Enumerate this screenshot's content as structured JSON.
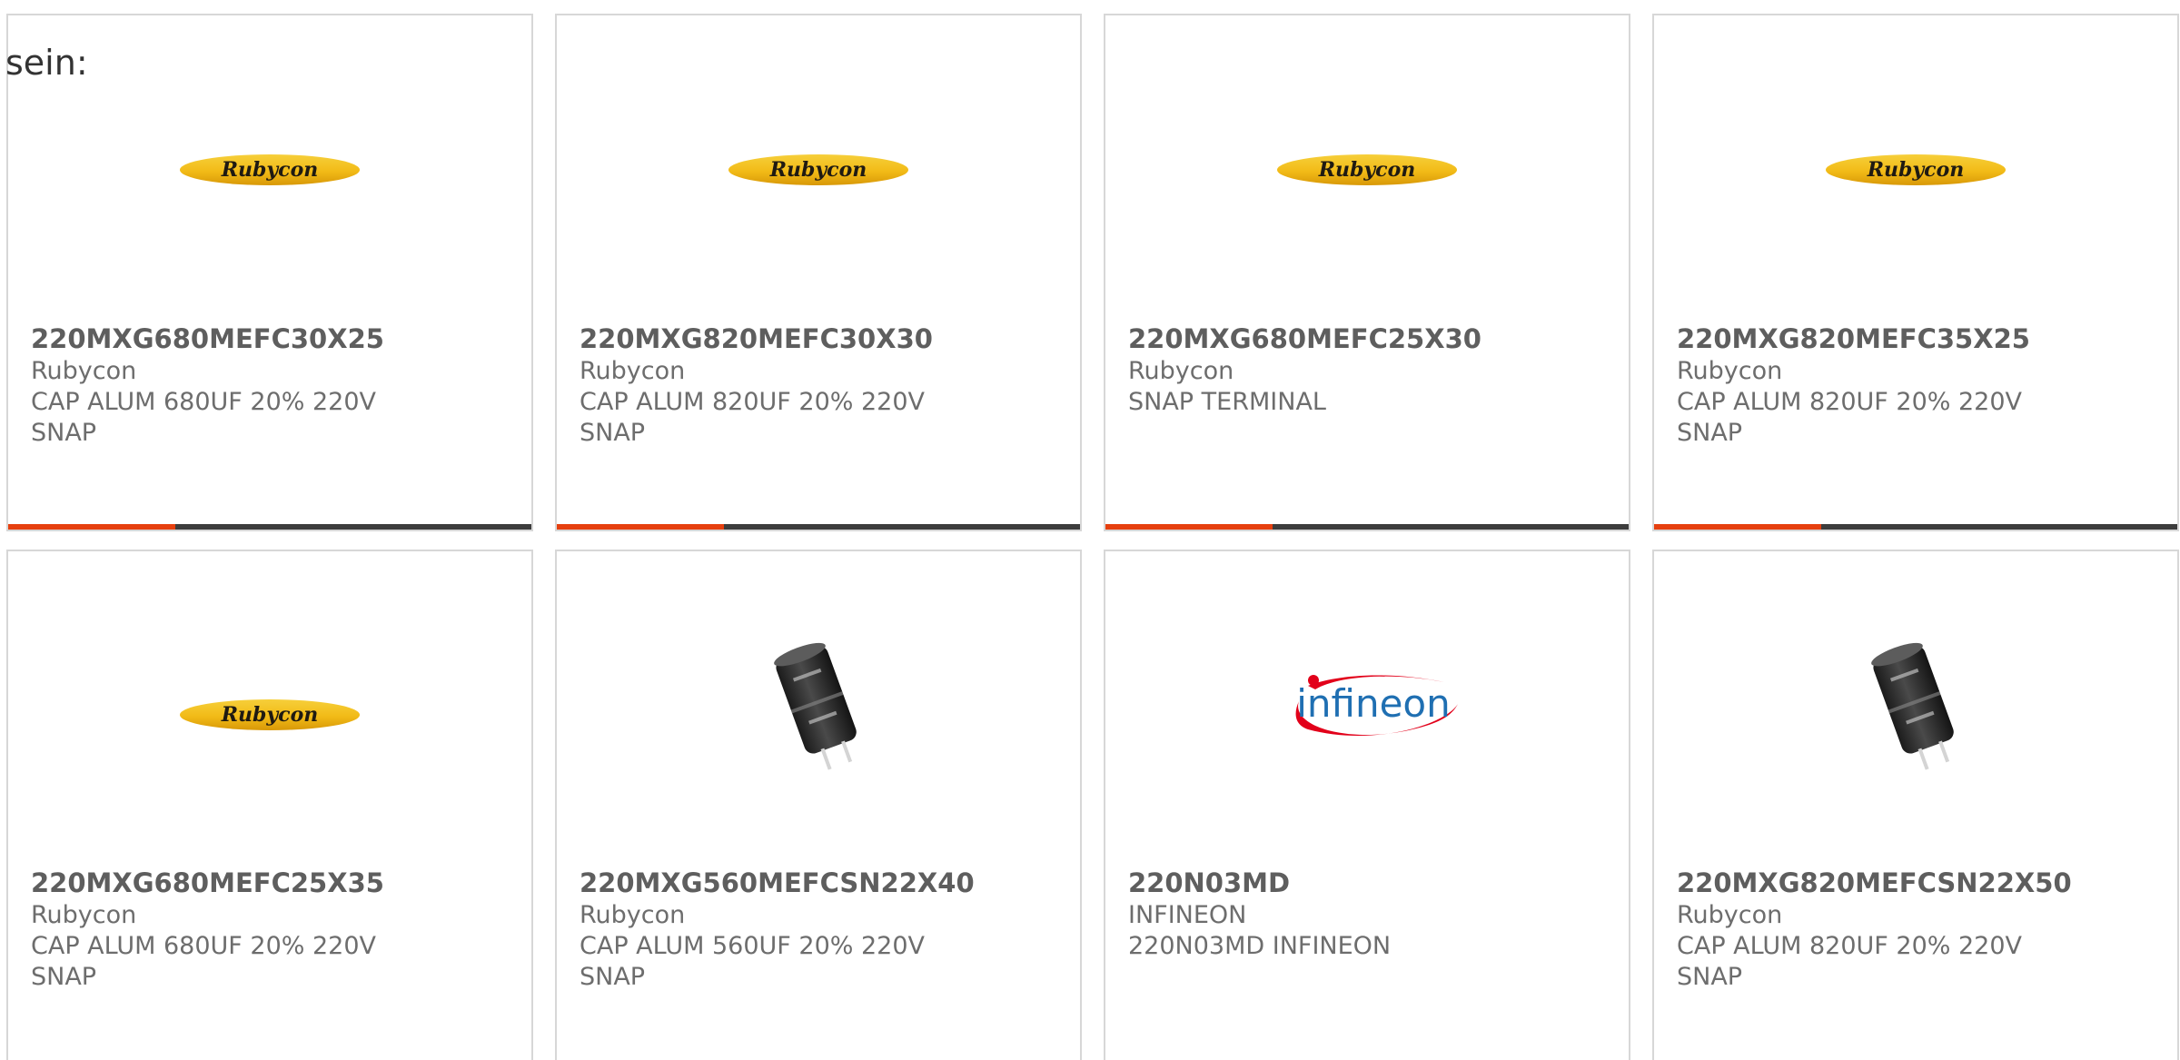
{
  "page": {
    "intro_text": "sein:"
  },
  "cards": [
    {
      "part_number": "220MXG680MEFC30X25",
      "manufacturer": "Rubycon",
      "description_line1": "CAP ALUM 680UF 20% 220V",
      "description_line2": "SNAP",
      "image": "rubycon-logo",
      "logo_text": "Rubycon"
    },
    {
      "part_number": "220MXG820MEFC30X30",
      "manufacturer": "Rubycon",
      "description_line1": "CAP ALUM 820UF 20% 220V",
      "description_line2": "SNAP",
      "image": "rubycon-logo",
      "logo_text": "Rubycon"
    },
    {
      "part_number": "220MXG680MEFC25X30",
      "manufacturer": "Rubycon",
      "description_line1": "SNAP TERMINAL",
      "description_line2": "",
      "image": "rubycon-logo",
      "logo_text": "Rubycon"
    },
    {
      "part_number": "220MXG820MEFC35X25",
      "manufacturer": "Rubycon",
      "description_line1": "CAP ALUM 820UF 20% 220V",
      "description_line2": "SNAP",
      "image": "rubycon-logo",
      "logo_text": "Rubycon"
    },
    {
      "part_number": "220MXG680MEFC25X35",
      "manufacturer": "Rubycon",
      "description_line1": "CAP ALUM 680UF 20% 220V",
      "description_line2": "SNAP",
      "image": "rubycon-logo",
      "logo_text": "Rubycon"
    },
    {
      "part_number": "220MXG560MEFCSN22X40",
      "manufacturer": "Rubycon",
      "description_line1": "CAP ALUM 560UF 20% 220V",
      "description_line2": "SNAP",
      "image": "capacitor-photo"
    },
    {
      "part_number": "220N03MD",
      "manufacturer": "INFINEON",
      "description_line1": "220N03MD INFINEON",
      "description_line2": "",
      "image": "infineon-logo",
      "logo_text": "infineon"
    },
    {
      "part_number": "220MXG820MEFCSN22X50",
      "manufacturer": "Rubycon",
      "description_line1": "CAP ALUM 820UF 20% 220V",
      "description_line2": "SNAP",
      "image": "capacitor-photo"
    }
  ],
  "colors": {
    "accent": "#e6400f",
    "bar_track": "#3d3d3d",
    "border": "#d7d7d7",
    "part_number_text": "#5e5e5e",
    "secondary_text": "#6d6d6d",
    "rubycon_yellow": "#f2bb17",
    "infineon_blue": "#1f6fb2",
    "infineon_red": "#e2001a"
  }
}
